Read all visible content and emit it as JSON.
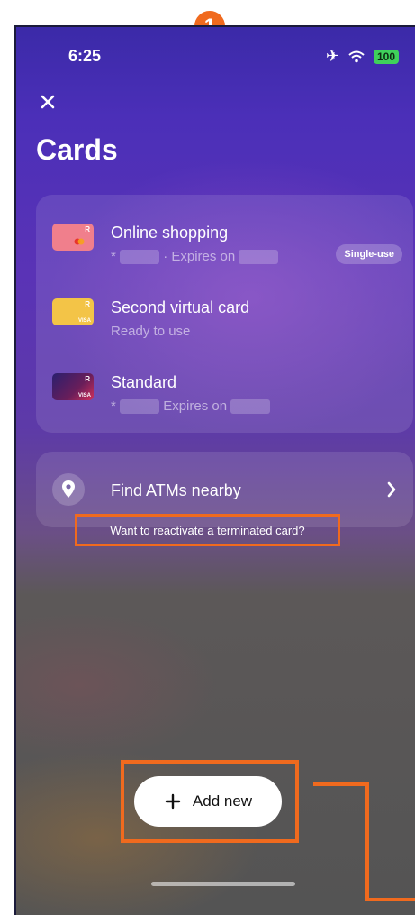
{
  "step_marker": "1",
  "status_bar": {
    "time": "6:25",
    "battery": "100",
    "airplane_icon": "airplane-icon",
    "wifi_icon": "wifi-icon"
  },
  "header": {
    "title": "Cards",
    "close_icon": "close-icon"
  },
  "cards": [
    {
      "name": "Online shopping",
      "masked_prefix": "*",
      "expires_text": "· Expires on",
      "badge": "Single-use",
      "thumb_color": "#f07f8c",
      "thumb_letter": "R"
    },
    {
      "name": "Second virtual card",
      "status": "Ready to use",
      "thumb_color": "#f3c447",
      "thumb_letter": "R",
      "thumb_brand": "VISA"
    },
    {
      "name": "Standard",
      "masked_prefix": "*",
      "expires_text": "Expires on",
      "thumb_color": "#2a1f6e",
      "thumb_letter": "R",
      "thumb_brand": "VISA"
    }
  ],
  "atm": {
    "label": "Find ATMs nearby",
    "icon": "map-pin-icon",
    "chevron_icon": "chevron-right-icon"
  },
  "reactivate_link": "Want to reactivate a terminated card?",
  "add_button": {
    "label": "Add new",
    "icon": "plus-icon"
  },
  "accent_color": "#f06a1e"
}
